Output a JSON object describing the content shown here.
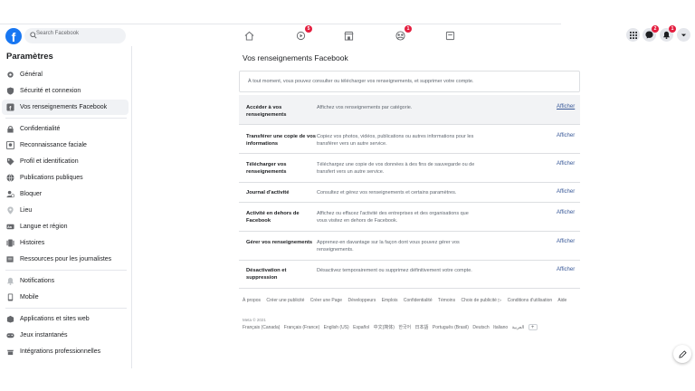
{
  "search": {
    "placeholder": "Search Facebook"
  },
  "nav": {
    "watch_badge": "5",
    "groups_badge": "1"
  },
  "right": {
    "messenger_badge": "2",
    "notifications_badge": "1"
  },
  "sidebar": {
    "title": "Paramètres",
    "items": [
      {
        "label": "Général",
        "icon": "gear-icon"
      },
      {
        "label": "Sécurité et connexion",
        "icon": "shield-icon"
      },
      {
        "label": "Vos renseignements Facebook",
        "icon": "facebook-icon"
      },
      {
        "label": "Confidentialité",
        "icon": "lock-icon"
      },
      {
        "label": "Reconnaissance faciale",
        "icon": "face-icon"
      },
      {
        "label": "Profil et identification",
        "icon": "tag-icon"
      },
      {
        "label": "Publications publiques",
        "icon": "globe-icon"
      },
      {
        "label": "Bloquer",
        "icon": "block-icon"
      },
      {
        "label": "Lieu",
        "icon": "location-icon"
      },
      {
        "label": "Langue et région",
        "icon": "language-icon"
      },
      {
        "label": "Histoires",
        "icon": "stories-icon"
      },
      {
        "label": "Ressources pour les journalistes",
        "icon": "journalist-icon"
      },
      {
        "label": "Notifications",
        "icon": "bell-icon"
      },
      {
        "label": "Mobile",
        "icon": "mobile-icon"
      },
      {
        "label": "Applications et sites web",
        "icon": "apps-icon"
      },
      {
        "label": "Jeux instantanés",
        "icon": "game-icon"
      },
      {
        "label": "Intégrations professionnelles",
        "icon": "business-icon"
      }
    ]
  },
  "main": {
    "title": "Vos renseignements Facebook",
    "intro": "À tout moment, vous pouvez consulter ou télécharger vos renseignements, et supprimer votre compte.",
    "rows": [
      {
        "label": "Accéder à vos renseignements",
        "desc": "Affichez vos renseignements par catégorie.",
        "link": "Afficher"
      },
      {
        "label": "Transférer une copie de vos informations",
        "desc": "Copiez vos photos, vidéos, publications ou autres informations pour les transférer vers un autre service.",
        "link": "Afficher"
      },
      {
        "label": "Télécharger vos renseignements",
        "desc": "Téléchargez une copie de vos données à des fins de sauvegarde ou de transfert vers un autre service.",
        "link": "Afficher"
      },
      {
        "label": "Journal d'activité",
        "desc": "Consultez et gérez vos renseignements et certains paramètres.",
        "link": "Afficher"
      },
      {
        "label": "Activité en dehors de Facebook",
        "desc": "Affichez ou effacez l'activité des entreprises et des organisations que vous visitez en dehors de Facebook.",
        "link": "Afficher"
      },
      {
        "label": "Gérer vos renseignements",
        "desc": "Apprenez-en davantage sur la façon dont vous pouvez gérer vos renseignements.",
        "link": "Afficher"
      },
      {
        "label": "Désactivation et suppression",
        "desc": "Désactivez temporairement ou supprimez définitivement votre compte.",
        "link": "Afficher"
      }
    ]
  },
  "footer": {
    "links": [
      "À propos",
      "Créer une publicité",
      "Créer une Page",
      "Développeurs",
      "Emplois",
      "Confidentialité",
      "Témoins",
      "Choix de publicité ▷",
      "Conditions d'utilisation",
      "Aide"
    ],
    "copyright": "Meta © 2021",
    "languages": [
      "Français (Canada)",
      "Français (France)",
      "English (US)",
      "Español",
      "中文(简体)",
      "한국어",
      "日本語",
      "Português (Brasil)",
      "Deutsch",
      "Italiano",
      "العربية"
    ],
    "more": "+"
  },
  "colors": {
    "brand": "#1877f2",
    "badge": "#e41e3f",
    "link": "#385898"
  }
}
